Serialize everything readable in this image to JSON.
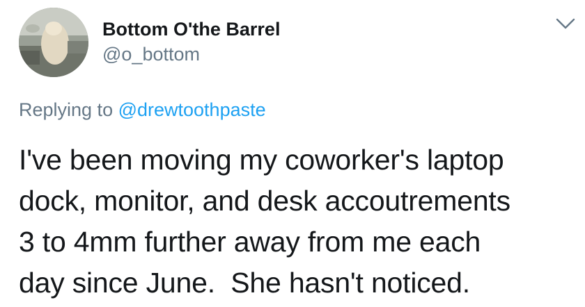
{
  "author": {
    "display_name": "Bottom O'the Barrel",
    "handle": "@o_bottom",
    "avatar_icon": "avatar-photo"
  },
  "menu": {
    "icon": "chevron-down-icon",
    "color": "#657786"
  },
  "reply": {
    "prefix": "Replying to ",
    "mention": "@drewtoothpaste",
    "mention_color": "#1da1f2"
  },
  "tweet": {
    "lines": [
      "I've been moving my coworker's laptop",
      "dock, monitor, and desk accoutrements",
      "3 to 4mm further away from me each",
      "day since June.  She hasn't noticed."
    ]
  }
}
